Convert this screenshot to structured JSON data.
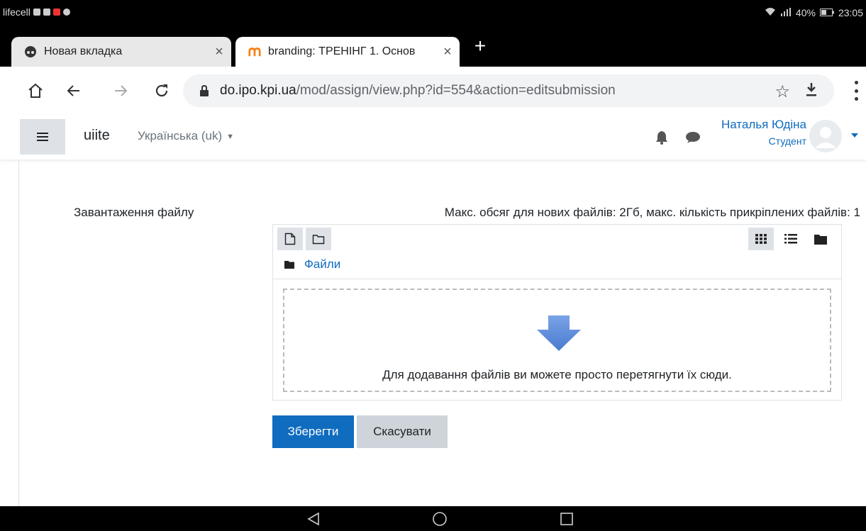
{
  "status_bar": {
    "carrier": "lifecell",
    "battery": "40%",
    "time": "23:05"
  },
  "tabs": [
    {
      "title": "Новая вкладка",
      "icon": "incognito-icon"
    },
    {
      "title": "branding: ТРЕНІНГ 1. Основ",
      "icon": "moodle-icon"
    }
  ],
  "address_bar": {
    "host": "do.ipo.kpi.ua",
    "path": "/mod/assign/view.php?id=554&action=editsubmission"
  },
  "site": {
    "brand": "uiite",
    "language": "Українська (uk)",
    "user_name": "Наталья Юдіна",
    "user_role": "Студент"
  },
  "form": {
    "field_label": "Завантаження файлу",
    "limits": "Макс. обсяг для нових файлів: 2Гб, макс. кількість прикріплених файлів: 1",
    "folder_path": "Файли",
    "drop_message": "Для додавання файлів ви можете просто перетягнути їх сюди.",
    "save_label": "Зберегти",
    "cancel_label": "Скасувати"
  },
  "colors": {
    "accent": "#0f6cbf",
    "secondary_button": "#ced4da",
    "arrow": "#5b8bd8"
  }
}
